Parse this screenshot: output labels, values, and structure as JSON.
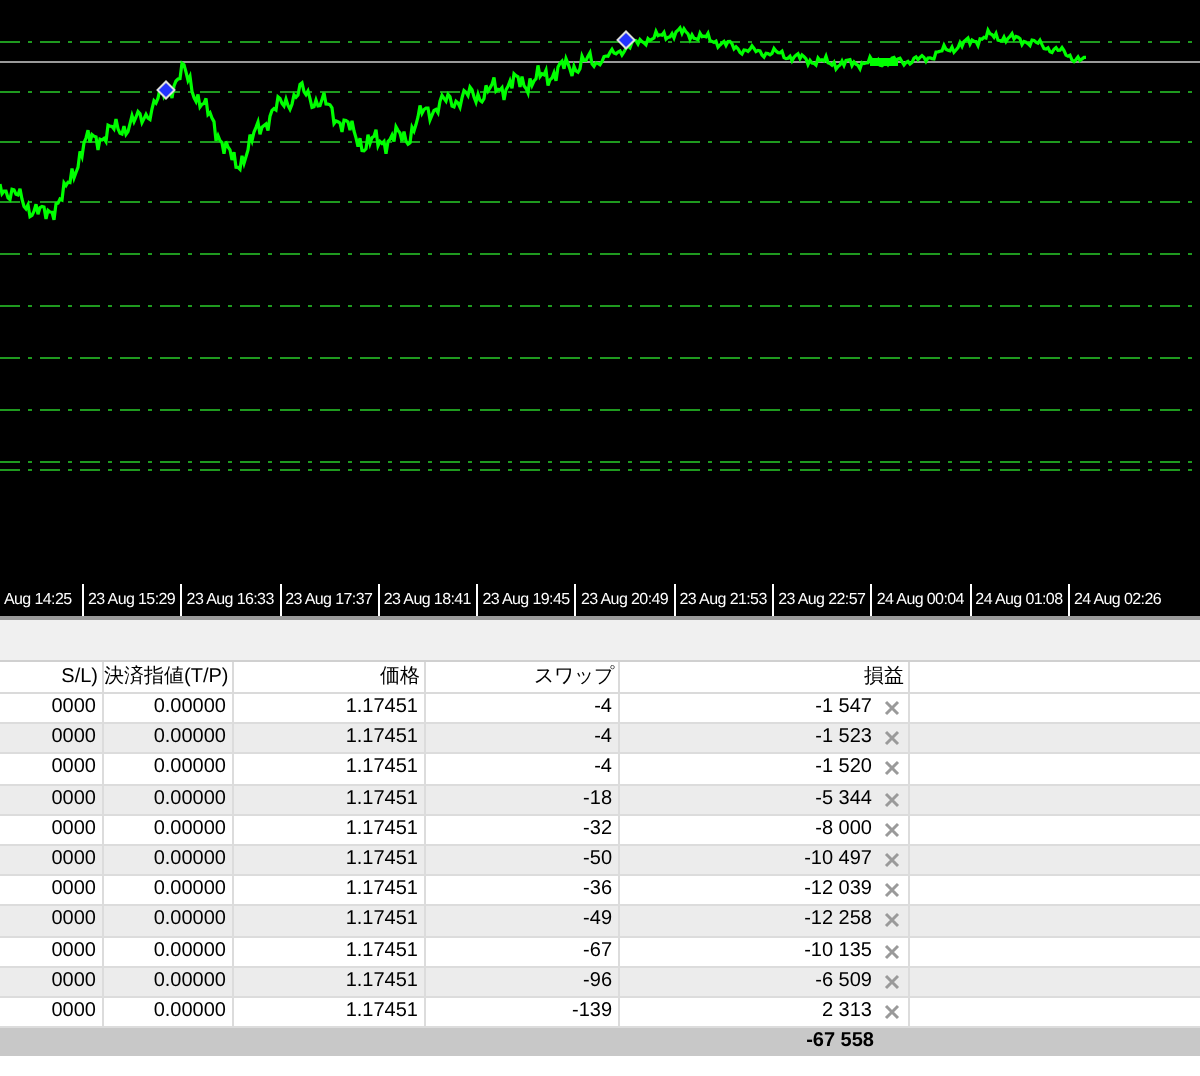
{
  "chart": {
    "time_labels": [
      "Aug 14:25",
      "23 Aug 15:29",
      "23 Aug 16:33",
      "23 Aug 17:37",
      "23 Aug 18:41",
      "23 Aug 19:45",
      "23 Aug 20:49",
      "23 Aug 21:53",
      "23 Aug 22:57",
      "24 Aug 00:04",
      "24 Aug 01:08",
      "24 Aug 02:26"
    ]
  },
  "table": {
    "columns": [
      "S/L)",
      "決済指値(T/P)",
      "価格",
      "スワップ",
      "損益"
    ],
    "rows": [
      {
        "sl": "0000",
        "tp": "0.00000",
        "price": "1.17451",
        "swap": "-4",
        "profit": "-1 547"
      },
      {
        "sl": "0000",
        "tp": "0.00000",
        "price": "1.17451",
        "swap": "-4",
        "profit": "-1 523"
      },
      {
        "sl": "0000",
        "tp": "0.00000",
        "price": "1.17451",
        "swap": "-4",
        "profit": "-1 520"
      },
      {
        "sl": "0000",
        "tp": "0.00000",
        "price": "1.17451",
        "swap": "-18",
        "profit": "-5 344"
      },
      {
        "sl": "0000",
        "tp": "0.00000",
        "price": "1.17451",
        "swap": "-32",
        "profit": "-8 000"
      },
      {
        "sl": "0000",
        "tp": "0.00000",
        "price": "1.17451",
        "swap": "-50",
        "profit": "-10 497"
      },
      {
        "sl": "0000",
        "tp": "0.00000",
        "price": "1.17451",
        "swap": "-36",
        "profit": "-12 039"
      },
      {
        "sl": "0000",
        "tp": "0.00000",
        "price": "1.17451",
        "swap": "-49",
        "profit": "-12 258"
      },
      {
        "sl": "0000",
        "tp": "0.00000",
        "price": "1.17451",
        "swap": "-67",
        "profit": "-10 135"
      },
      {
        "sl": "0000",
        "tp": "0.00000",
        "price": "1.17451",
        "swap": "-96",
        "profit": "-6 509"
      },
      {
        "sl": "0000",
        "tp": "0.00000",
        "price": "1.17451",
        "swap": "-139",
        "profit": "2 313"
      }
    ],
    "total": "-67 558"
  }
}
